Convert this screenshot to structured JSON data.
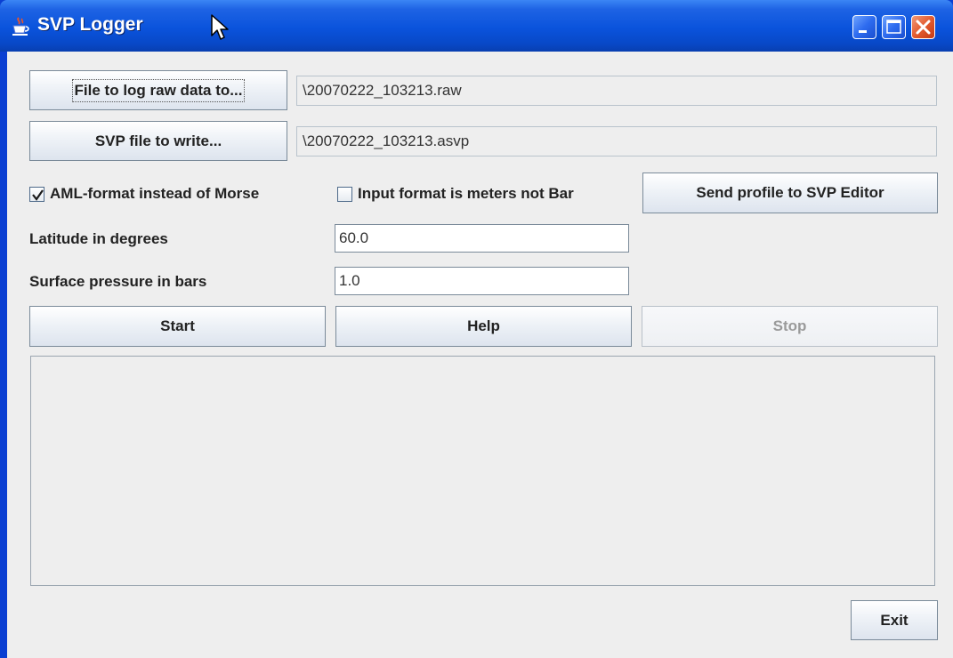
{
  "window": {
    "title": "SVP Logger"
  },
  "files": {
    "raw_button_label": "File to log raw data to...",
    "raw_path": "\\20070222_103213.raw",
    "svp_button_label": "SVP file to write...",
    "svp_path": "\\20070222_103213.asvp"
  },
  "options": {
    "aml_label": "AML-format instead of Morse",
    "aml_checked": true,
    "meters_label": "Input format is meters not Bar",
    "meters_checked": false,
    "send_button_label": "Send profile to SVP Editor"
  },
  "params": {
    "latitude_label": "Latitude in degrees",
    "latitude_value": "60.0",
    "pressure_label": "Surface pressure in bars",
    "pressure_value": "1.0"
  },
  "actions": {
    "start_label": "Start",
    "help_label": "Help",
    "stop_label": "Stop",
    "stop_enabled": false
  },
  "log": {
    "text": ""
  },
  "footer": {
    "exit_label": "Exit"
  },
  "colors": {
    "titlebar": "#0a53dc",
    "client_bg": "#eeeeee",
    "close_button": "#e35b2f"
  }
}
